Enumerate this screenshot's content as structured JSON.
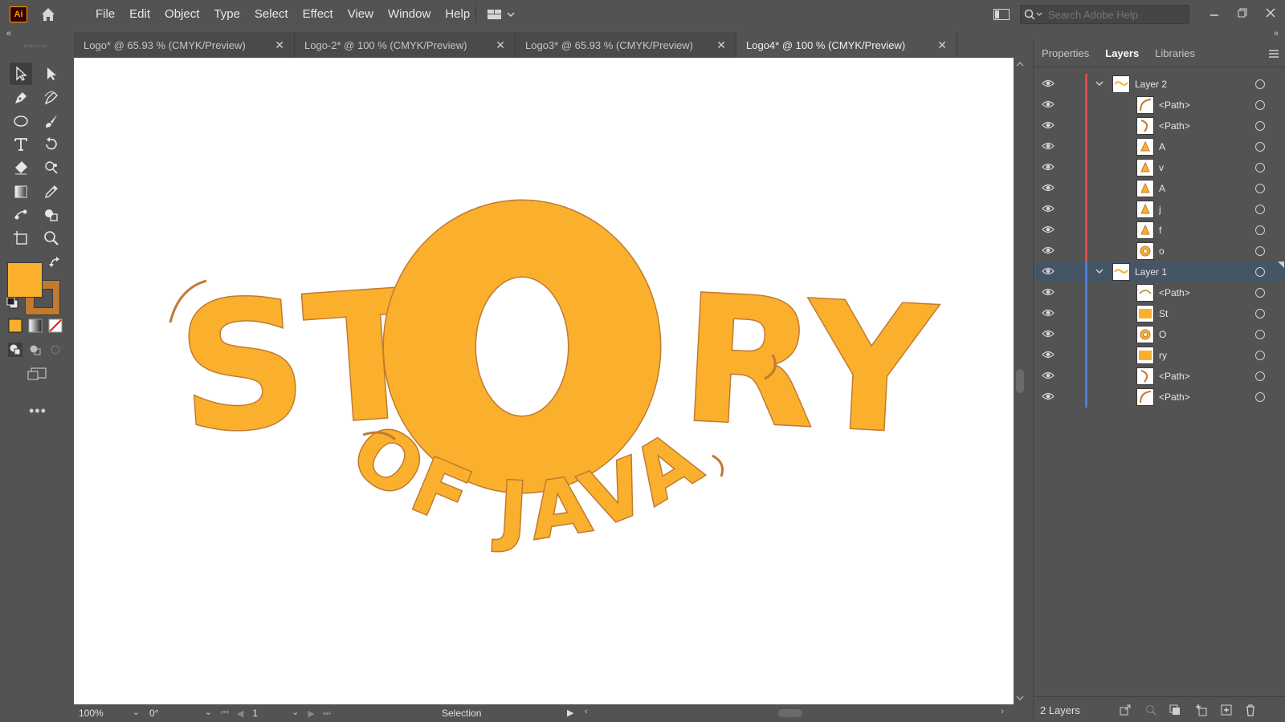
{
  "app": {
    "logo_text": "Ai"
  },
  "menu": [
    "File",
    "Edit",
    "Object",
    "Type",
    "Select",
    "Effect",
    "View",
    "Window",
    "Help"
  ],
  "search": {
    "placeholder": "Search Adobe Help"
  },
  "tabs": [
    {
      "label": "Logo* @ 65.93 % (CMYK/Preview)",
      "active": false
    },
    {
      "label": "Logo-2* @ 100 % (CMYK/Preview)",
      "active": false
    },
    {
      "label": "Logo3* @ 65.93 % (CMYK/Preview)",
      "active": false
    },
    {
      "label": "Logo4* @ 100 % (CMYK/Preview)",
      "active": true
    }
  ],
  "tab_close_glyph": "✕",
  "colors": {
    "fill": "#fbb02d",
    "stroke": "#c17a30",
    "layer2_color": "#e0474c",
    "layer1_color": "#4b7bd8"
  },
  "artwork": {
    "line1_left": "ST",
    "big_o": "O",
    "line1_right": "RY",
    "line2": "OF JAVA"
  },
  "status": {
    "zoom": "100%",
    "rotation": "0°",
    "artboard": "1",
    "tool": "Selection"
  },
  "panel": {
    "tabs": [
      {
        "label": "Properties",
        "active": false
      },
      {
        "label": "Layers",
        "active": true
      },
      {
        "label": "Libraries",
        "active": false
      }
    ],
    "layers": [
      {
        "name": "Layer 2",
        "level": "top",
        "group": "layer2",
        "thumb": "layer",
        "selected": false
      },
      {
        "name": "<Path>",
        "level": "sub",
        "group": "layer2",
        "thumb": "path-arc-left",
        "selected": false
      },
      {
        "name": "<Path>",
        "level": "sub",
        "group": "layer2",
        "thumb": "path-arc-right",
        "selected": false
      },
      {
        "name": "A",
        "level": "sub",
        "group": "layer2",
        "thumb": "letter",
        "selected": false
      },
      {
        "name": "v",
        "level": "sub",
        "group": "layer2",
        "thumb": "letter",
        "selected": false
      },
      {
        "name": "A",
        "level": "sub",
        "group": "layer2",
        "thumb": "letter",
        "selected": false
      },
      {
        "name": "j",
        "level": "sub",
        "group": "layer2",
        "thumb": "letter",
        "selected": false
      },
      {
        "name": "f",
        "level": "sub",
        "group": "layer2",
        "thumb": "letter",
        "selected": false
      },
      {
        "name": "o",
        "level": "sub",
        "group": "layer2",
        "thumb": "ring",
        "selected": false
      },
      {
        "name": "Layer 1",
        "level": "top",
        "group": "layer1",
        "thumb": "layer",
        "selected": true
      },
      {
        "name": "<Path>",
        "level": "sub",
        "group": "layer1",
        "thumb": "path-top",
        "selected": false
      },
      {
        "name": "St",
        "level": "sub",
        "group": "layer1",
        "thumb": "text-st",
        "selected": false
      },
      {
        "name": "O",
        "level": "sub",
        "group": "layer1",
        "thumb": "ring",
        "selected": false
      },
      {
        "name": "ry",
        "level": "sub",
        "group": "layer1",
        "thumb": "text-ry",
        "selected": false
      },
      {
        "name": "<Path>",
        "level": "sub",
        "group": "layer1",
        "thumb": "path-arc-right",
        "selected": false
      },
      {
        "name": "<Path>",
        "level": "sub",
        "group": "layer1",
        "thumb": "path-arc-left",
        "selected": false
      }
    ],
    "layer_count": "2 Layers"
  }
}
